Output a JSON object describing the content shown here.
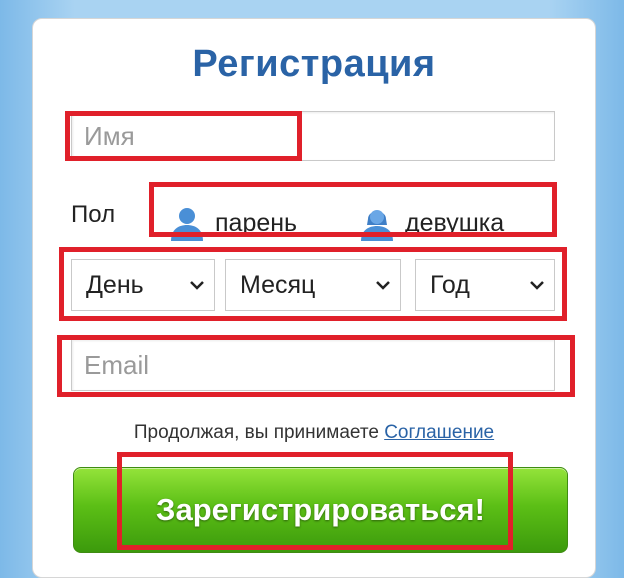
{
  "form": {
    "title": "Регистрация",
    "name_placeholder": "Имя",
    "gender_label": "Пол",
    "gender_options": [
      {
        "label": "парень",
        "icon": "male-user-icon"
      },
      {
        "label": "девушка",
        "icon": "female-user-icon"
      }
    ],
    "birth_day": "День",
    "birth_month": "Месяц",
    "birth_year": "Год",
    "email_placeholder": "Email",
    "agree_text": "Продолжая, вы принимаете",
    "agree_link": "Соглашение",
    "submit_label": "Зарегистрироваться!"
  },
  "colors": {
    "title": "#2a63a6",
    "highlight": "#e0202a",
    "button": "#5cbf16",
    "link": "#2a63a6"
  }
}
